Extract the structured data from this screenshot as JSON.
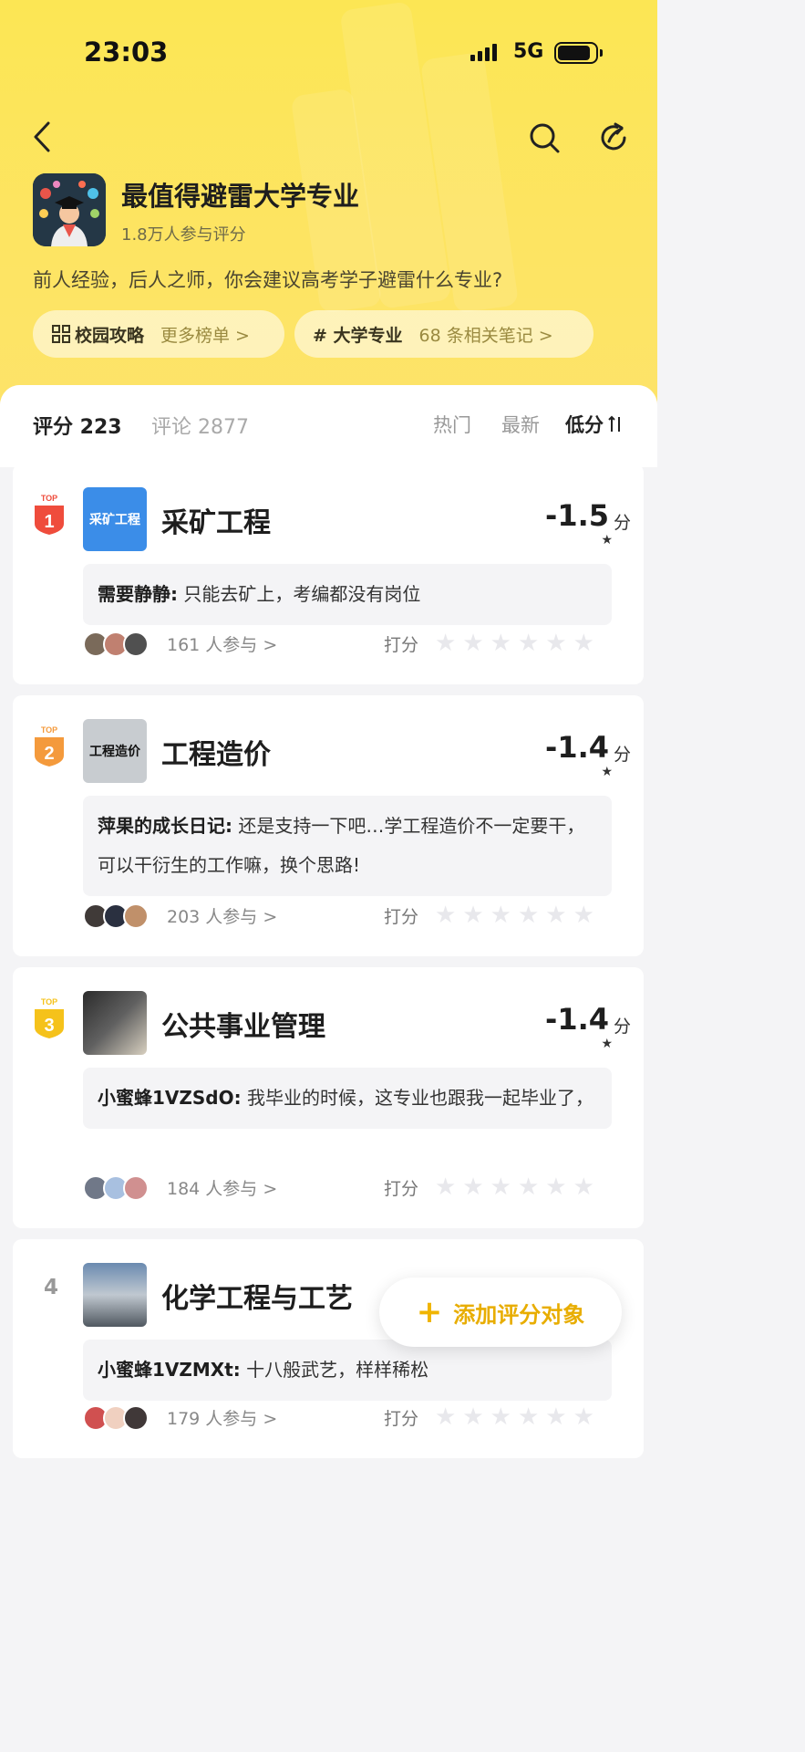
{
  "status_bar": {
    "time": "23:03",
    "network": "5G"
  },
  "nav": {
    "back_icon": "back-arrow-icon",
    "search_icon": "search-icon",
    "share_icon": "share-icon"
  },
  "header": {
    "title": "最值得避雷大学专业",
    "participants": "1.8万人参与评分",
    "description": "前人经验，后人之师，你会建议高考学子避雷什么专业?",
    "chips": [
      {
        "icon": "grid-icon",
        "label": "校园攻略",
        "sub": "更多榜单 >"
      },
      {
        "icon": "hash-icon",
        "label": "# 大学专业",
        "sub": "68 条相关笔记 >"
      }
    ]
  },
  "tabs": {
    "rating": "评分 223",
    "comments": "评论 2877",
    "sort": [
      "热门",
      "最新",
      "低分"
    ],
    "sort_active": "低分",
    "sort_icon": "sort-icon"
  },
  "items": [
    {
      "rank": "1",
      "thumb_text": "采矿工程",
      "name": "采矿工程",
      "score": "-1.5",
      "unit": "分",
      "comment_user": "需要静静:",
      "comment_text": "只能去矿上，考编都没有岗位",
      "participants": "161 人参与 >",
      "rate_label": "打分"
    },
    {
      "rank": "2",
      "thumb_text": "工程造价",
      "name": "工程造价",
      "score": "-1.4",
      "unit": "分",
      "comment_user": "萍果的成长日记:",
      "comment_text": "还是支持一下吧…学工程造价不一定要干，可以干衍生的工作嘛，换个思路!",
      "participants": "203 人参与 >",
      "rate_label": "打分"
    },
    {
      "rank": "3",
      "thumb_text": "",
      "name": "公共事业管理",
      "score": "-1.4",
      "unit": "分",
      "comment_user": "小蜜蜂1VZSdO:",
      "comment_text": "我毕业的时候，这专业也跟我一起毕业了，",
      "participants": "184 人参与 >",
      "rate_label": "打分"
    },
    {
      "rank": "4",
      "thumb_text": "",
      "name": "化学工程与工艺",
      "score": "",
      "unit": "",
      "comment_user": "小蜜蜂1VZMXt:",
      "comment_text": "十八般武艺，样样稀松",
      "participants": "179 人参与 >",
      "rate_label": "打分"
    }
  ],
  "fab": {
    "label": "添加评分对象",
    "icon": "plus-icon"
  },
  "colors": {
    "brand_yellow": "#fde454",
    "accent": "#f0b400",
    "rank1": "#ef4c3c",
    "rank2": "#f49a3c",
    "rank3": "#f5c21b"
  }
}
